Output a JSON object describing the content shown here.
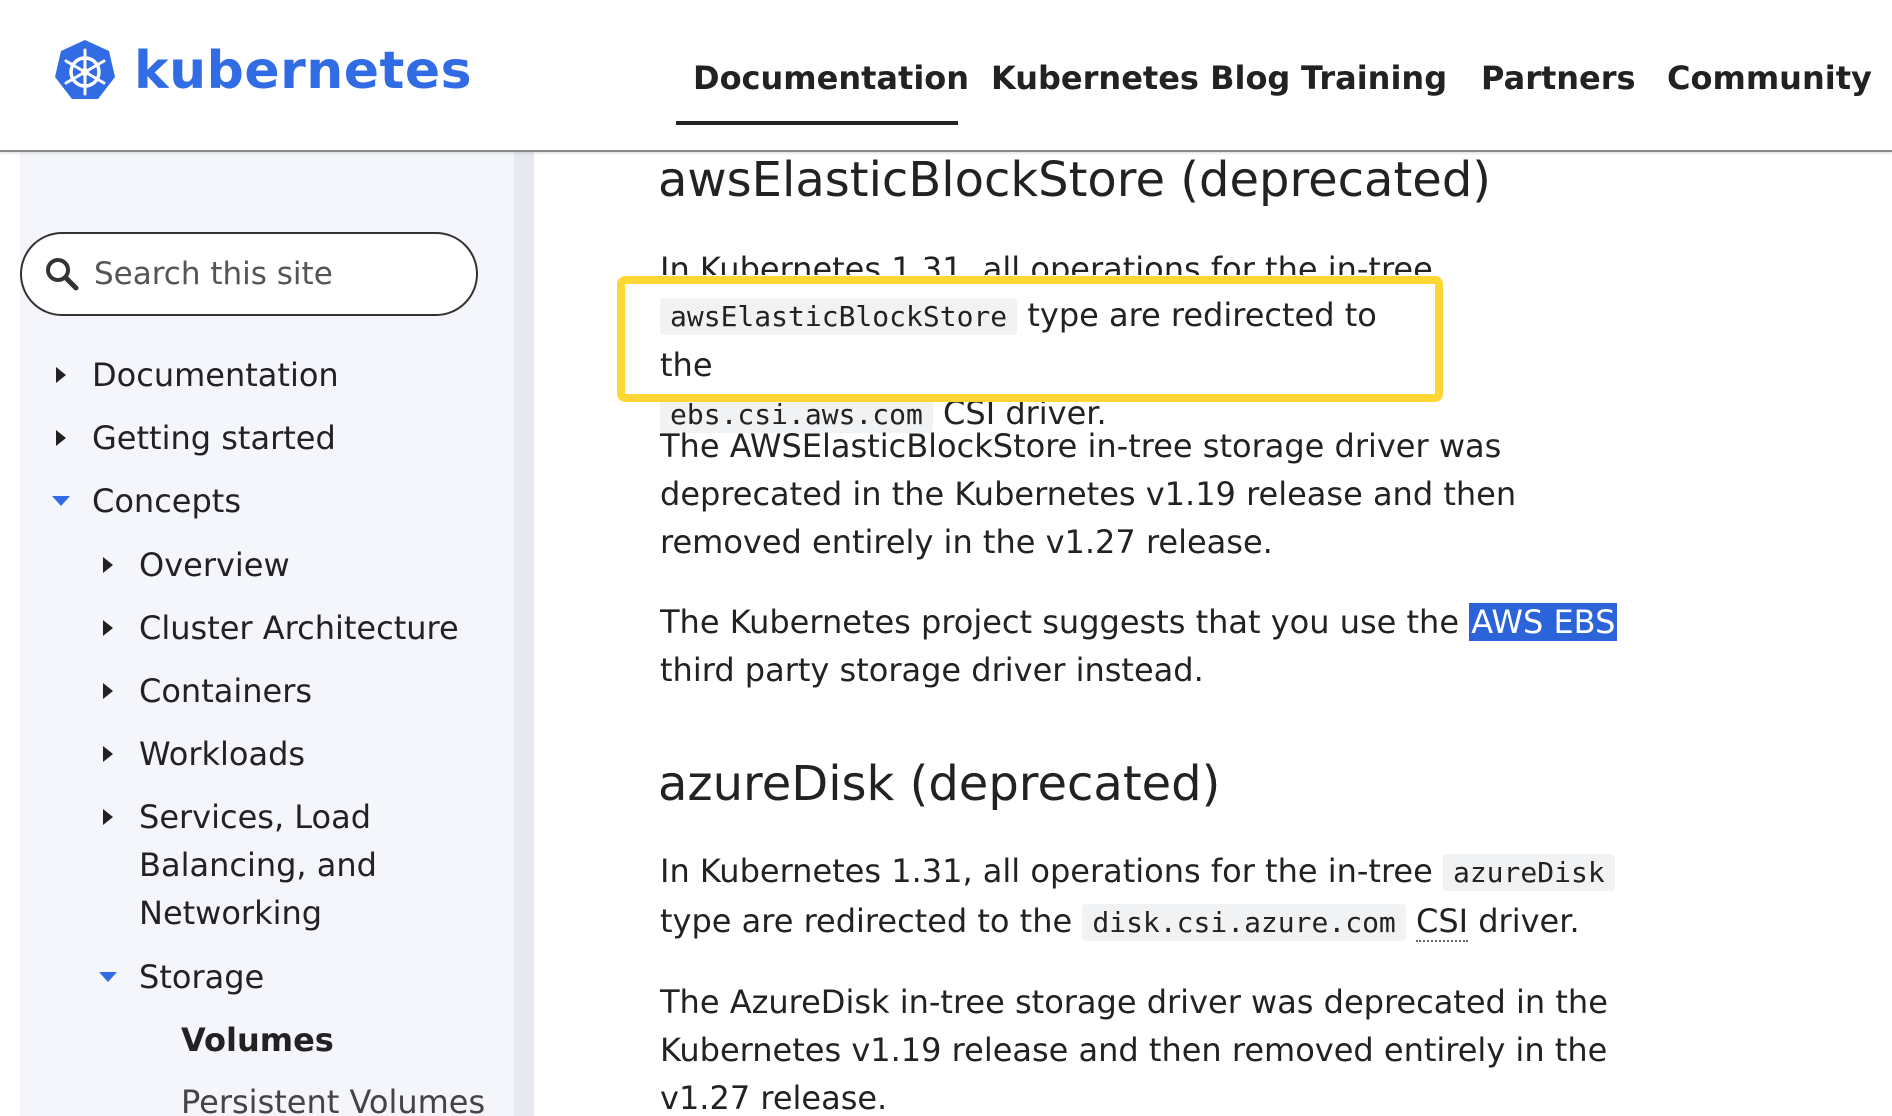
{
  "header": {
    "logo_text": "kubernetes",
    "nav": [
      "Documentation",
      "Kubernetes Blog",
      "Training",
      "Partners",
      "Community"
    ],
    "active_nav": "Documentation"
  },
  "sidebar": {
    "search_placeholder": "Search this site",
    "items": [
      {
        "label": "Documentation",
        "state": "collapsed"
      },
      {
        "label": "Getting started",
        "state": "collapsed"
      },
      {
        "label": "Concepts",
        "state": "expanded"
      },
      {
        "label": "Overview",
        "state": "collapsed"
      },
      {
        "label": "Cluster Architecture",
        "state": "collapsed"
      },
      {
        "label": "Containers",
        "state": "collapsed"
      },
      {
        "label": "Workloads",
        "state": "collapsed"
      },
      {
        "label": "Services, Load Balancing, and Networking",
        "state": "collapsed"
      },
      {
        "label": "Storage",
        "state": "expanded"
      },
      {
        "label": "Volumes",
        "state": "active"
      },
      {
        "label": "Persistent Volumes",
        "state": "leaf"
      }
    ]
  },
  "content": {
    "section1": {
      "heading": "awsElasticBlockStore (deprecated)",
      "p1_prefix": "In Kubernetes 1.31, all operations for the in-tree",
      "p1_code1": "awsElasticBlockStore",
      "p1_mid": "type are redirected to the",
      "p1_code2": "ebs.csi.aws.com",
      "p1_suffix": "CSI driver.",
      "p2": "The AWSElasticBlockStore in-tree storage driver was deprecated in the Kubernetes v1.19 release and then removed entirely in the v1.27 release.",
      "p3_prefix": "The Kubernetes project suggests that you use the",
      "p3_link": "AWS EBS",
      "p3_suffix": "third party storage driver instead."
    },
    "section2": {
      "heading": "azureDisk (deprecated)",
      "p1_prefix": "In Kubernetes 1.31, all operations for the in-tree",
      "p1_code1": "azureDisk",
      "p1_mid": "type are redirected to the",
      "p1_code2": "disk.csi.azure.com",
      "p1_abbr": "CSI",
      "p1_suffix": "driver.",
      "p2": "The AzureDisk in-tree storage driver was deprecated in the Kubernetes v1.19 release and then removed entirely in the v1.27 release."
    }
  },
  "colors": {
    "brand": "#326ce5",
    "highlight_box": "#fdd835",
    "link_selection": "#2b63d9"
  }
}
